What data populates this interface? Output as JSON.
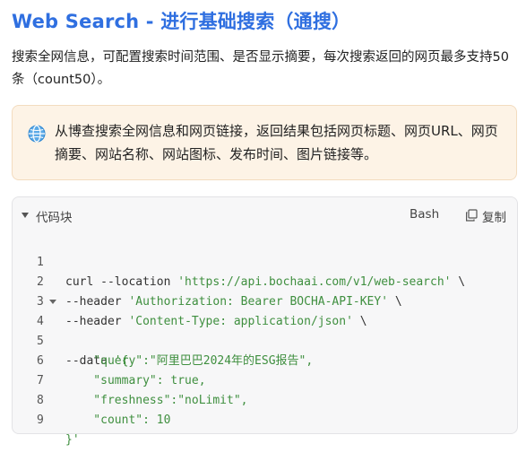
{
  "title": "Web Search - 进行基础搜索（通搜）",
  "description": "搜索全网信息，可配置搜索时间范围、是否显示摘要，每次搜索返回的网页最多支持50条（count50）。",
  "callout": {
    "icon": "globe-icon",
    "text": "从博查搜索全网信息和网页链接，返回结果包括网页标题、网页URL、网页摘要、网站名称、网站图标、发布时间、图片链接等。"
  },
  "code_block": {
    "label": "代码块",
    "language": "Bash",
    "copy_label": "复制",
    "lines": [
      {
        "num": "1",
        "text": "curl --location 'https://api.bochaai.com/v1/web-search' \\"
      },
      {
        "num": "2",
        "text": "--header 'Authorization: Bearer BOCHA-API-KEY' \\"
      },
      {
        "num": "3",
        "text": "--header 'Content-Type: application/json' \\"
      },
      {
        "num": "4",
        "text": "--data '{"
      },
      {
        "num": "5",
        "text": "    \"query\":\"阿里巴巴2024年的ESG报告\","
      },
      {
        "num": "6",
        "text": "    \"summary\": true,"
      },
      {
        "num": "7",
        "text": "    \"freshness\":\"noLimit\","
      },
      {
        "num": "8",
        "text": "    \"count\": 10"
      },
      {
        "num": "9",
        "text": "}'"
      }
    ]
  },
  "colors": {
    "title": "#2f6fe0",
    "callout_bg": "#fdf3e6",
    "string": "#3f8f3f",
    "key": "#2a6fbf"
  }
}
